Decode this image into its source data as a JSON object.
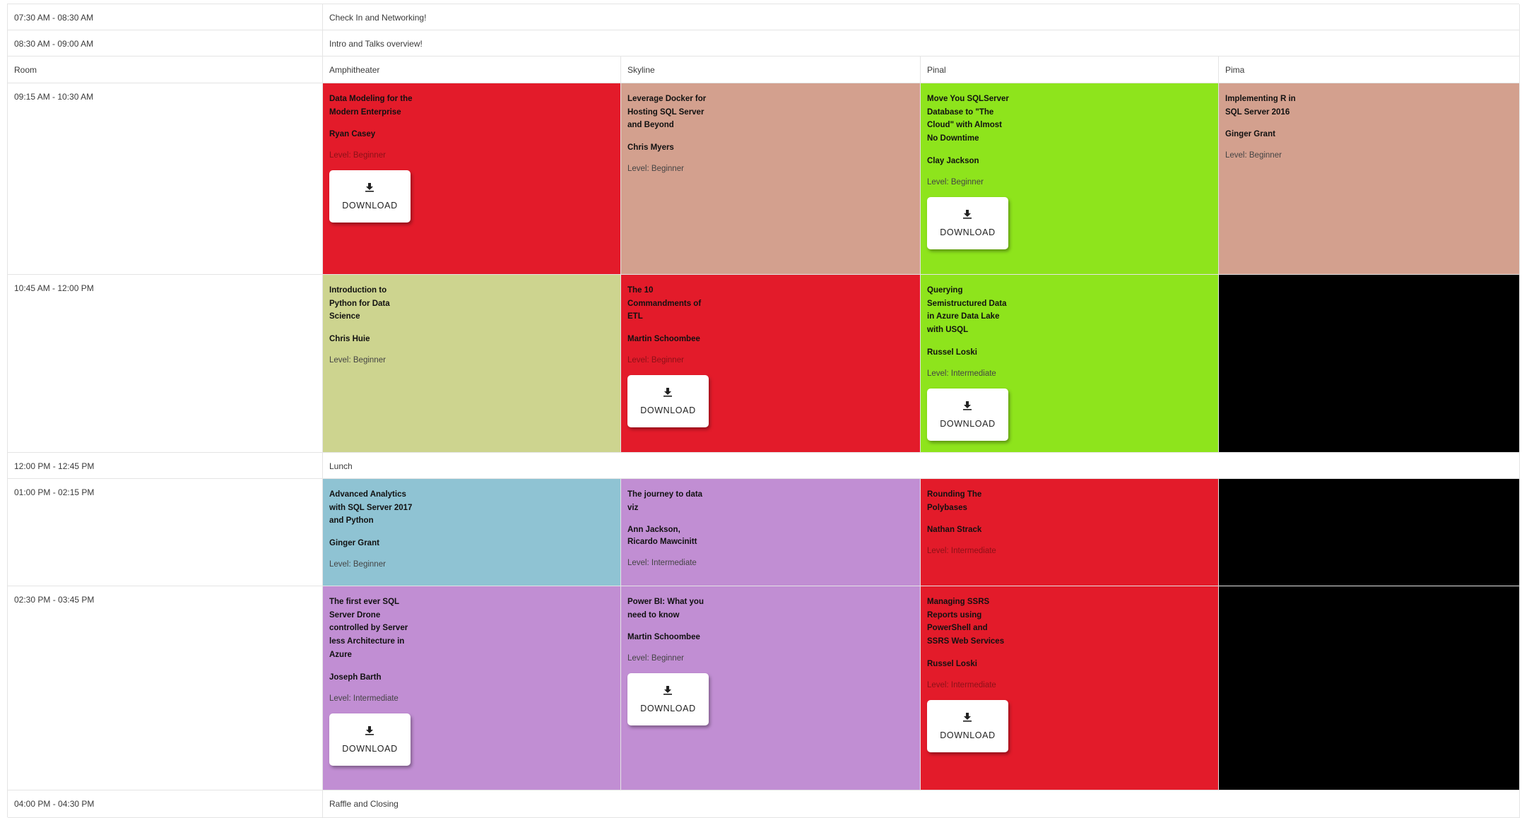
{
  "rows": {
    "r1": {
      "time": "07:30 AM - 08:30 AM",
      "text": "Check In and Networking!"
    },
    "r2": {
      "time": "08:30 AM - 09:00 AM",
      "text": "Intro and Talks overview!"
    },
    "rooms": {
      "label": "Room",
      "names": [
        "Amphitheater",
        "Skyline",
        "Pinal",
        "Pima"
      ]
    },
    "s1": {
      "time": "09:15 AM - 10:30 AM",
      "sessions": [
        {
          "title": "Data Modeling for the Modern Enterprise",
          "speaker": "Ryan Casey",
          "level": "Level: Beginner",
          "download": "DOWNLOAD",
          "color": "#e31b2a"
        },
        {
          "title": "Leverage Docker for Hosting SQL Server and Beyond",
          "speaker": "Chris Myers",
          "level": "Level: Beginner",
          "color": "#d3a08e"
        },
        {
          "title": "Move You SQLServer Database to \"The Cloud\" with Almost No Downtime",
          "speaker": "Clay Jackson",
          "level": "Level: Beginner",
          "download": "DOWNLOAD",
          "color": "#8ee41c"
        },
        {
          "title": "Implementing R in SQL Server 2016",
          "speaker": "Ginger Grant",
          "level": "Level: Beginner",
          "color": "#d3a08e"
        }
      ]
    },
    "s2": {
      "time": "10:45 AM - 12:00 PM",
      "sessions": [
        {
          "title": "Introduction to Python for Data Science",
          "speaker": "Chris Huie",
          "level": "Level: Beginner",
          "color": "#cdd48f"
        },
        {
          "title": "The 10 Commandments of ETL",
          "speaker": "Martin Schoombee",
          "level": "Level: Beginner",
          "download": "DOWNLOAD",
          "color": "#e31b2a"
        },
        {
          "title": "Querying Semistructured Data in Azure Data Lake with USQL",
          "speaker": "Russel Loski",
          "level": "Level: Intermediate",
          "download": "DOWNLOAD",
          "color": "#8ee41c"
        }
      ],
      "empty_color": "#000000"
    },
    "lunch": {
      "time": "12:00 PM - 12:45 PM",
      "text": "Lunch"
    },
    "s3": {
      "time": "01:00 PM - 02:15 PM",
      "sessions": [
        {
          "title": "Advanced Analytics with SQL Server 2017 and Python",
          "speaker": "Ginger Grant",
          "level": "Level: Beginner",
          "color": "#8fc3d3"
        },
        {
          "title": "The journey to data viz",
          "speaker": "Ann Jackson, Ricardo Mawcinitt",
          "level": "Level: Intermediate",
          "color": "#c18ed3"
        },
        {
          "title": "Rounding The Polybases",
          "speaker": "Nathan Strack",
          "level": "Level: Intermediate",
          "color": "#e31b2a"
        }
      ],
      "empty_color": "#000000"
    },
    "s4": {
      "time": "02:30 PM - 03:45 PM",
      "sessions": [
        {
          "title": "The first ever SQL Server Drone controlled by Server less Architecture in Azure",
          "speaker": "Joseph Barth",
          "level": "Level: Intermediate",
          "download": "DOWNLOAD",
          "color": "#c18ed3"
        },
        {
          "title": "Power BI: What you need to know",
          "speaker": "Martin Schoombee",
          "level": "Level: Beginner",
          "download": "DOWNLOAD",
          "color": "#c18ed3"
        },
        {
          "title": "Managing SSRS Reports using PowerShell and SSRS Web Services",
          "speaker": "Russel Loski",
          "level": "Level: Intermediate",
          "download": "DOWNLOAD",
          "color": "#e31b2a"
        }
      ],
      "empty_color": "#000000"
    },
    "r_end": {
      "time": "04:00 PM - 04:30 PM",
      "text": "Raffle and Closing"
    }
  },
  "icons": {
    "download": "download-icon"
  }
}
